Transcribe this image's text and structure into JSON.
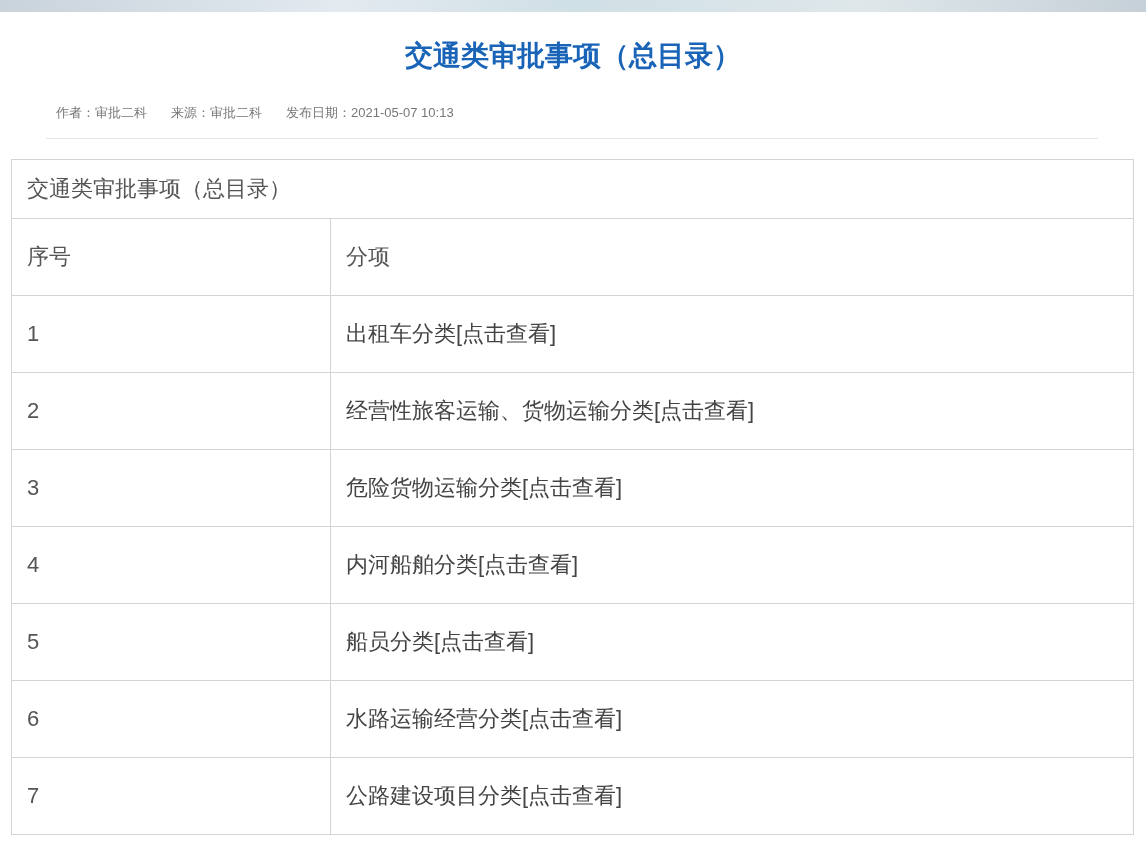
{
  "article": {
    "title": "交通类审批事项（总目录）",
    "meta": [
      {
        "label": "作者：",
        "value": "审批二科"
      },
      {
        "label": "来源：",
        "value": "审批二科"
      },
      {
        "label": "发布日期：",
        "value": "2021-05-07 10:13"
      }
    ]
  },
  "table": {
    "caption": "交通类审批事项（总目录）",
    "columns": [
      "序号",
      "分项"
    ],
    "rows": [
      {
        "number": "1",
        "item": "出租车分类[点击查看]"
      },
      {
        "number": "2",
        "item": "经营性旅客运输、货物运输分类[点击查看]"
      },
      {
        "number": "3",
        "item": "危险货物运输分类[点击查看]"
      },
      {
        "number": "4",
        "item": "内河船舶分类[点击查看]"
      },
      {
        "number": "5",
        "item": "船员分类[点击查看]"
      },
      {
        "number": "6",
        "item": "水路运输经营分类[点击查看]"
      },
      {
        "number": "7",
        "item": "公路建设项目分类[点击查看]"
      }
    ]
  }
}
